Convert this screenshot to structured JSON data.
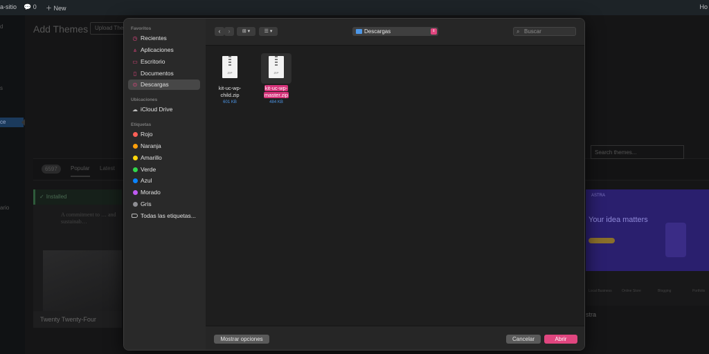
{
  "wordpress": {
    "adminbar": {
      "site": "a-sitio",
      "comments": "0",
      "new": "New",
      "howdy": "Ho"
    },
    "sidebar": {
      "items": [
        "d",
        "s",
        "ce",
        "ario"
      ]
    },
    "page_title": "Add Themes",
    "upload_button": "Upload The",
    "filter": {
      "count": "6597",
      "tab_popular": "Popular",
      "tab_latest": "Latest"
    },
    "search_placeholder": "Search themes...",
    "themes": [
      {
        "name": "Twenty Twenty-Four",
        "installed_label": "Installed",
        "tagline": "A commitment to … and sustainab…"
      },
      {
        "name": "stra",
        "logo": "ASTRA",
        "headline": "Your idea matters",
        "features": [
          "Local Business",
          "Online Store",
          "Blogging",
          "Portfolio"
        ]
      }
    ]
  },
  "dialog": {
    "sidebar": {
      "favorites_title": "Favoritos",
      "favorites": [
        {
          "label": "Recientes",
          "icon": "clock-icon"
        },
        {
          "label": "Aplicaciones",
          "icon": "applications-icon"
        },
        {
          "label": "Escritorio",
          "icon": "desktop-icon"
        },
        {
          "label": "Documentos",
          "icon": "document-icon"
        },
        {
          "label": "Descargas",
          "icon": "downloads-icon",
          "selected": true
        }
      ],
      "locations_title": "Ubicaciones",
      "locations": [
        {
          "label": "iCloud Drive",
          "icon": "cloud-icon"
        }
      ],
      "tags_title": "Etiquetas",
      "tags": [
        {
          "label": "Rojo",
          "color": "#ff5f57"
        },
        {
          "label": "Naranja",
          "color": "#ff9f0a"
        },
        {
          "label": "Amarillo",
          "color": "#ffd60a"
        },
        {
          "label": "Verde",
          "color": "#32d74b"
        },
        {
          "label": "Azul",
          "color": "#0a84ff"
        },
        {
          "label": "Morado",
          "color": "#bf5af2"
        },
        {
          "label": "Gris",
          "color": "#8e8e93"
        }
      ],
      "all_tags": "Todas las etiquetas..."
    },
    "toolbar": {
      "back": "‹",
      "forward": "›",
      "icon_view": "⊞ ▾",
      "list_view": "☰ ▾",
      "location": "Descargas",
      "search_placeholder": "Buscar"
    },
    "files": [
      {
        "name_line1": "kit-uc-wp-",
        "name_line2": "child.zip",
        "size": "601 KB",
        "badge": "ZIP",
        "selected": false
      },
      {
        "name_line1": "kit-uc-wp-",
        "name_line2": "master.zip",
        "size": "484 KB",
        "badge": "ZIP",
        "selected": true
      }
    ],
    "buttons": {
      "options": "Mostrar opciones",
      "cancel": "Cancelar",
      "open": "Abrir"
    },
    "colors": {
      "accent": "#e0467f",
      "selection": "#d6337a",
      "folder": "#4d97e8"
    }
  }
}
